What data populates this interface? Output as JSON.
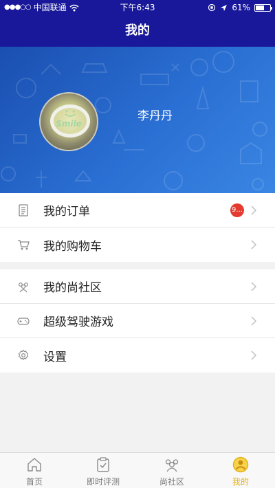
{
  "status_bar": {
    "signal": "●●●○○",
    "carrier": "中国联通",
    "time": "下午6:43",
    "battery_percent": "61%",
    "battery_level": 0.61
  },
  "header": {
    "title": "我的"
  },
  "profile": {
    "username": "李丹丹",
    "avatar_text": "Smile"
  },
  "menu_group_1": [
    {
      "label": "我的订单",
      "icon": "document-list-icon",
      "badge": "9..."
    },
    {
      "label": "我的购物车",
      "icon": "cart-icon"
    }
  ],
  "menu_group_2": [
    {
      "label": "我的尚社区",
      "icon": "community-icon"
    },
    {
      "label": "超级驾驶游戏",
      "icon": "gamepad-icon"
    },
    {
      "label": "设置",
      "icon": "gear-icon"
    }
  ],
  "tabbar": {
    "tabs": [
      {
        "label": "首页",
        "icon": "home-icon"
      },
      {
        "label": "即时评测",
        "icon": "clipboard-check-icon"
      },
      {
        "label": "尚社区",
        "icon": "people-icon"
      },
      {
        "label": "我的",
        "icon": "user-circle-icon",
        "active": true
      }
    ]
  },
  "colors": {
    "nav_bg": "#19189a",
    "banner": "#2a6fd3",
    "badge": "#e53a2f",
    "active_tab": "#e3b21a"
  }
}
